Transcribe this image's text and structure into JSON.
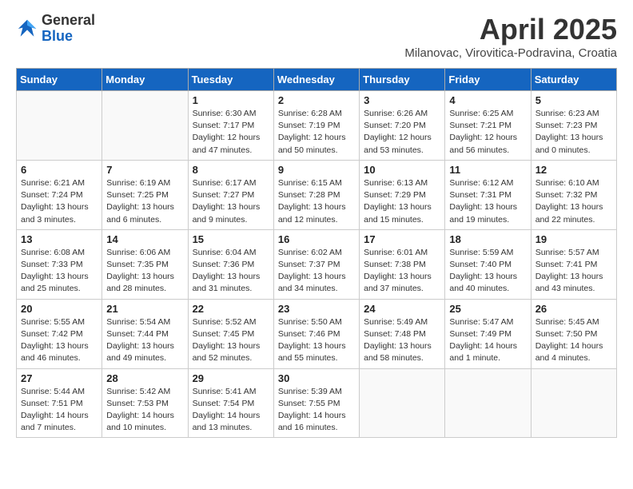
{
  "logo": {
    "general": "General",
    "blue": "Blue"
  },
  "title": {
    "month": "April 2025",
    "location": "Milanovac, Virovitica-Podravina, Croatia"
  },
  "weekdays": [
    "Sunday",
    "Monday",
    "Tuesday",
    "Wednesday",
    "Thursday",
    "Friday",
    "Saturday"
  ],
  "weeks": [
    [
      {
        "day": "",
        "detail": ""
      },
      {
        "day": "",
        "detail": ""
      },
      {
        "day": "1",
        "detail": "Sunrise: 6:30 AM\nSunset: 7:17 PM\nDaylight: 12 hours\nand 47 minutes."
      },
      {
        "day": "2",
        "detail": "Sunrise: 6:28 AM\nSunset: 7:19 PM\nDaylight: 12 hours\nand 50 minutes."
      },
      {
        "day": "3",
        "detail": "Sunrise: 6:26 AM\nSunset: 7:20 PM\nDaylight: 12 hours\nand 53 minutes."
      },
      {
        "day": "4",
        "detail": "Sunrise: 6:25 AM\nSunset: 7:21 PM\nDaylight: 12 hours\nand 56 minutes."
      },
      {
        "day": "5",
        "detail": "Sunrise: 6:23 AM\nSunset: 7:23 PM\nDaylight: 13 hours\nand 0 minutes."
      }
    ],
    [
      {
        "day": "6",
        "detail": "Sunrise: 6:21 AM\nSunset: 7:24 PM\nDaylight: 13 hours\nand 3 minutes."
      },
      {
        "day": "7",
        "detail": "Sunrise: 6:19 AM\nSunset: 7:25 PM\nDaylight: 13 hours\nand 6 minutes."
      },
      {
        "day": "8",
        "detail": "Sunrise: 6:17 AM\nSunset: 7:27 PM\nDaylight: 13 hours\nand 9 minutes."
      },
      {
        "day": "9",
        "detail": "Sunrise: 6:15 AM\nSunset: 7:28 PM\nDaylight: 13 hours\nand 12 minutes."
      },
      {
        "day": "10",
        "detail": "Sunrise: 6:13 AM\nSunset: 7:29 PM\nDaylight: 13 hours\nand 15 minutes."
      },
      {
        "day": "11",
        "detail": "Sunrise: 6:12 AM\nSunset: 7:31 PM\nDaylight: 13 hours\nand 19 minutes."
      },
      {
        "day": "12",
        "detail": "Sunrise: 6:10 AM\nSunset: 7:32 PM\nDaylight: 13 hours\nand 22 minutes."
      }
    ],
    [
      {
        "day": "13",
        "detail": "Sunrise: 6:08 AM\nSunset: 7:33 PM\nDaylight: 13 hours\nand 25 minutes."
      },
      {
        "day": "14",
        "detail": "Sunrise: 6:06 AM\nSunset: 7:35 PM\nDaylight: 13 hours\nand 28 minutes."
      },
      {
        "day": "15",
        "detail": "Sunrise: 6:04 AM\nSunset: 7:36 PM\nDaylight: 13 hours\nand 31 minutes."
      },
      {
        "day": "16",
        "detail": "Sunrise: 6:02 AM\nSunset: 7:37 PM\nDaylight: 13 hours\nand 34 minutes."
      },
      {
        "day": "17",
        "detail": "Sunrise: 6:01 AM\nSunset: 7:38 PM\nDaylight: 13 hours\nand 37 minutes."
      },
      {
        "day": "18",
        "detail": "Sunrise: 5:59 AM\nSunset: 7:40 PM\nDaylight: 13 hours\nand 40 minutes."
      },
      {
        "day": "19",
        "detail": "Sunrise: 5:57 AM\nSunset: 7:41 PM\nDaylight: 13 hours\nand 43 minutes."
      }
    ],
    [
      {
        "day": "20",
        "detail": "Sunrise: 5:55 AM\nSunset: 7:42 PM\nDaylight: 13 hours\nand 46 minutes."
      },
      {
        "day": "21",
        "detail": "Sunrise: 5:54 AM\nSunset: 7:44 PM\nDaylight: 13 hours\nand 49 minutes."
      },
      {
        "day": "22",
        "detail": "Sunrise: 5:52 AM\nSunset: 7:45 PM\nDaylight: 13 hours\nand 52 minutes."
      },
      {
        "day": "23",
        "detail": "Sunrise: 5:50 AM\nSunset: 7:46 PM\nDaylight: 13 hours\nand 55 minutes."
      },
      {
        "day": "24",
        "detail": "Sunrise: 5:49 AM\nSunset: 7:48 PM\nDaylight: 13 hours\nand 58 minutes."
      },
      {
        "day": "25",
        "detail": "Sunrise: 5:47 AM\nSunset: 7:49 PM\nDaylight: 14 hours\nand 1 minute."
      },
      {
        "day": "26",
        "detail": "Sunrise: 5:45 AM\nSunset: 7:50 PM\nDaylight: 14 hours\nand 4 minutes."
      }
    ],
    [
      {
        "day": "27",
        "detail": "Sunrise: 5:44 AM\nSunset: 7:51 PM\nDaylight: 14 hours\nand 7 minutes."
      },
      {
        "day": "28",
        "detail": "Sunrise: 5:42 AM\nSunset: 7:53 PM\nDaylight: 14 hours\nand 10 minutes."
      },
      {
        "day": "29",
        "detail": "Sunrise: 5:41 AM\nSunset: 7:54 PM\nDaylight: 14 hours\nand 13 minutes."
      },
      {
        "day": "30",
        "detail": "Sunrise: 5:39 AM\nSunset: 7:55 PM\nDaylight: 14 hours\nand 16 minutes."
      },
      {
        "day": "",
        "detail": ""
      },
      {
        "day": "",
        "detail": ""
      },
      {
        "day": "",
        "detail": ""
      }
    ]
  ]
}
